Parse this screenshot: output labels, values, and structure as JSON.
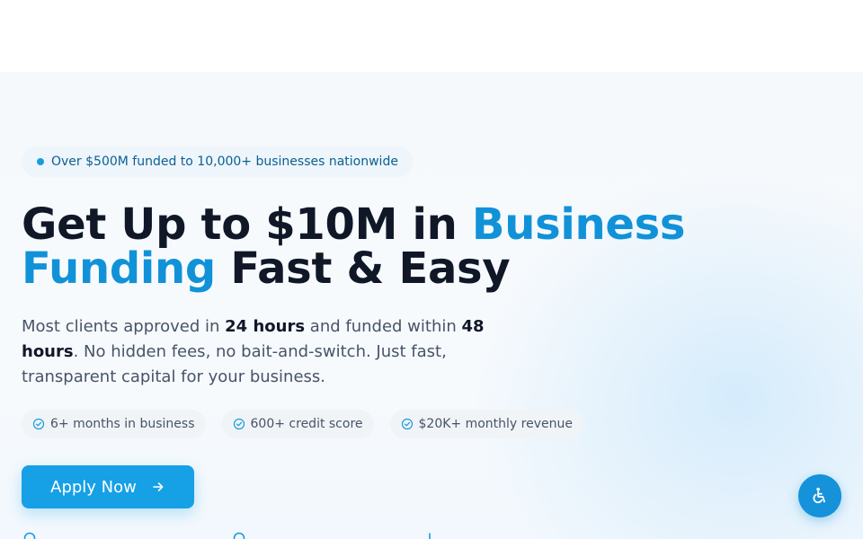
{
  "hero": {
    "badge": "Over $500M funded to 10,000+ businesses nationwide",
    "headline": {
      "part1": "Get Up to $10M in ",
      "accent1": "Business",
      "accent2": "Funding",
      "part2": " Fast & Easy"
    },
    "subtext": {
      "t1": "Most clients approved in ",
      "b1": "24 hours",
      "t2": " and funded within ",
      "b2": "48 hours",
      "t3": ". No hidden fees, no bait-and-switch. Just fast, transparent capital for your business."
    },
    "requirements": [
      {
        "label": "6+ months in business",
        "icon": "check-circle-icon"
      },
      {
        "label": "600+ credit score",
        "icon": "check-circle-icon"
      },
      {
        "label": "$20K+ monthly revenue",
        "icon": "check-circle-icon"
      }
    ],
    "cta_label": "Apply Now"
  },
  "colors": {
    "accent": "#1192d8",
    "button": "#16a0e6",
    "heading": "#101828",
    "body": "#475467"
  },
  "icons": {
    "cta": "arrow-right-icon",
    "accessibility": "accessibility-icon"
  }
}
